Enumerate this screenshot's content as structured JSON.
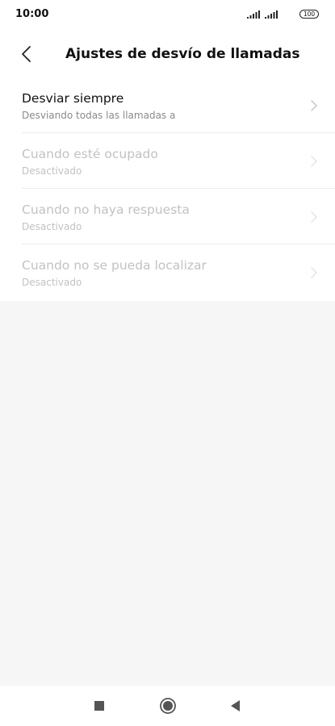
{
  "status_bar": {
    "time": "10:00",
    "battery": "100",
    "icons": [
      "signal-icon",
      "signal-icon",
      "battery-icon"
    ]
  },
  "header": {
    "title": "Ajustes de desvío de llamadas",
    "back_icon": "chevron-left-icon"
  },
  "items": [
    {
      "title": "Desviar siempre",
      "subtitle": "Desviando todas las llamadas a",
      "enabled": true
    },
    {
      "title": "Cuando esté ocupado",
      "subtitle": "Desactivado",
      "enabled": false
    },
    {
      "title": "Cuando no haya respuesta",
      "subtitle": "Desactivado",
      "enabled": false
    },
    {
      "title": "Cuando no se pueda localizar",
      "subtitle": "Desactivado",
      "enabled": false
    }
  ],
  "nav_bar": {
    "icons": [
      "square-icon",
      "circle-home-icon",
      "triangle-back-icon"
    ]
  },
  "colors": {
    "background": "#f6f6f6",
    "surface": "#ffffff",
    "text_primary": "#111111",
    "text_secondary": "#8a8a8a",
    "text_disabled": "#c2c2c2",
    "divider": "#ececec"
  }
}
